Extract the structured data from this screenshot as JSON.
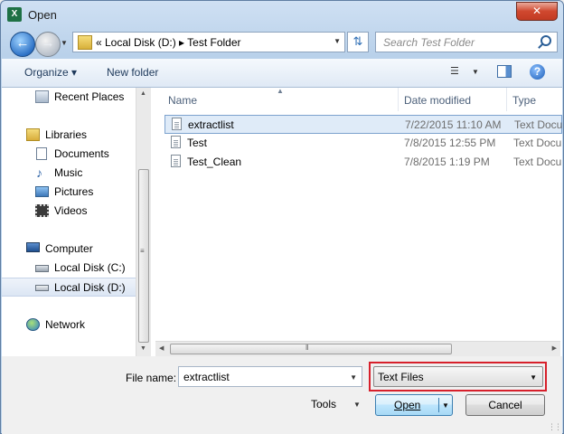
{
  "window": {
    "title": "Open",
    "app_icon_label": "X",
    "close_label": "✕"
  },
  "navbar": {
    "address_path": "«  Local Disk (D:)  ▸  Test Folder",
    "search_placeholder": "Search Test Folder"
  },
  "toolbar": {
    "organize_label": "Organize ▾",
    "new_folder_label": "New folder",
    "help_label": "?"
  },
  "sidebar": {
    "items": [
      {
        "label": "Recent Places",
        "icon": "recent-places-icon",
        "selected": false
      },
      {
        "label": "Libraries",
        "icon": "libraries-icon",
        "selected": false
      },
      {
        "label": "Documents",
        "icon": "documents-icon",
        "selected": false
      },
      {
        "label": "Music",
        "icon": "music-icon",
        "selected": false
      },
      {
        "label": "Pictures",
        "icon": "pictures-icon",
        "selected": false
      },
      {
        "label": "Videos",
        "icon": "videos-icon",
        "selected": false
      },
      {
        "label": "Computer",
        "icon": "computer-icon",
        "selected": false
      },
      {
        "label": "Local Disk (C:)",
        "icon": "drive-c-icon",
        "selected": false
      },
      {
        "label": "Local Disk (D:)",
        "icon": "drive-d-icon",
        "selected": true
      },
      {
        "label": "Network",
        "icon": "network-icon",
        "selected": false
      }
    ]
  },
  "file_list": {
    "columns": [
      "Name",
      "Date modified",
      "Type"
    ],
    "rows": [
      {
        "name": "extractlist",
        "date": "7/22/2015 11:10 AM",
        "type": "Text Docu",
        "selected": true
      },
      {
        "name": "Test",
        "date": "7/8/2015 12:55 PM",
        "type": "Text Docu",
        "selected": false
      },
      {
        "name": "Test_Clean",
        "date": "7/8/2015 1:19 PM",
        "type": "Text Docu",
        "selected": false
      }
    ]
  },
  "bottom": {
    "file_name_label": "File name:",
    "file_name_value": "extractlist",
    "filter_value": "Text Files",
    "tools_label": "Tools",
    "open_label": "Open",
    "cancel_label": "Cancel"
  },
  "colors": {
    "highlight_outline": "#d7202b",
    "selection": "#dfebf8",
    "accent": "#3c7fb1"
  }
}
